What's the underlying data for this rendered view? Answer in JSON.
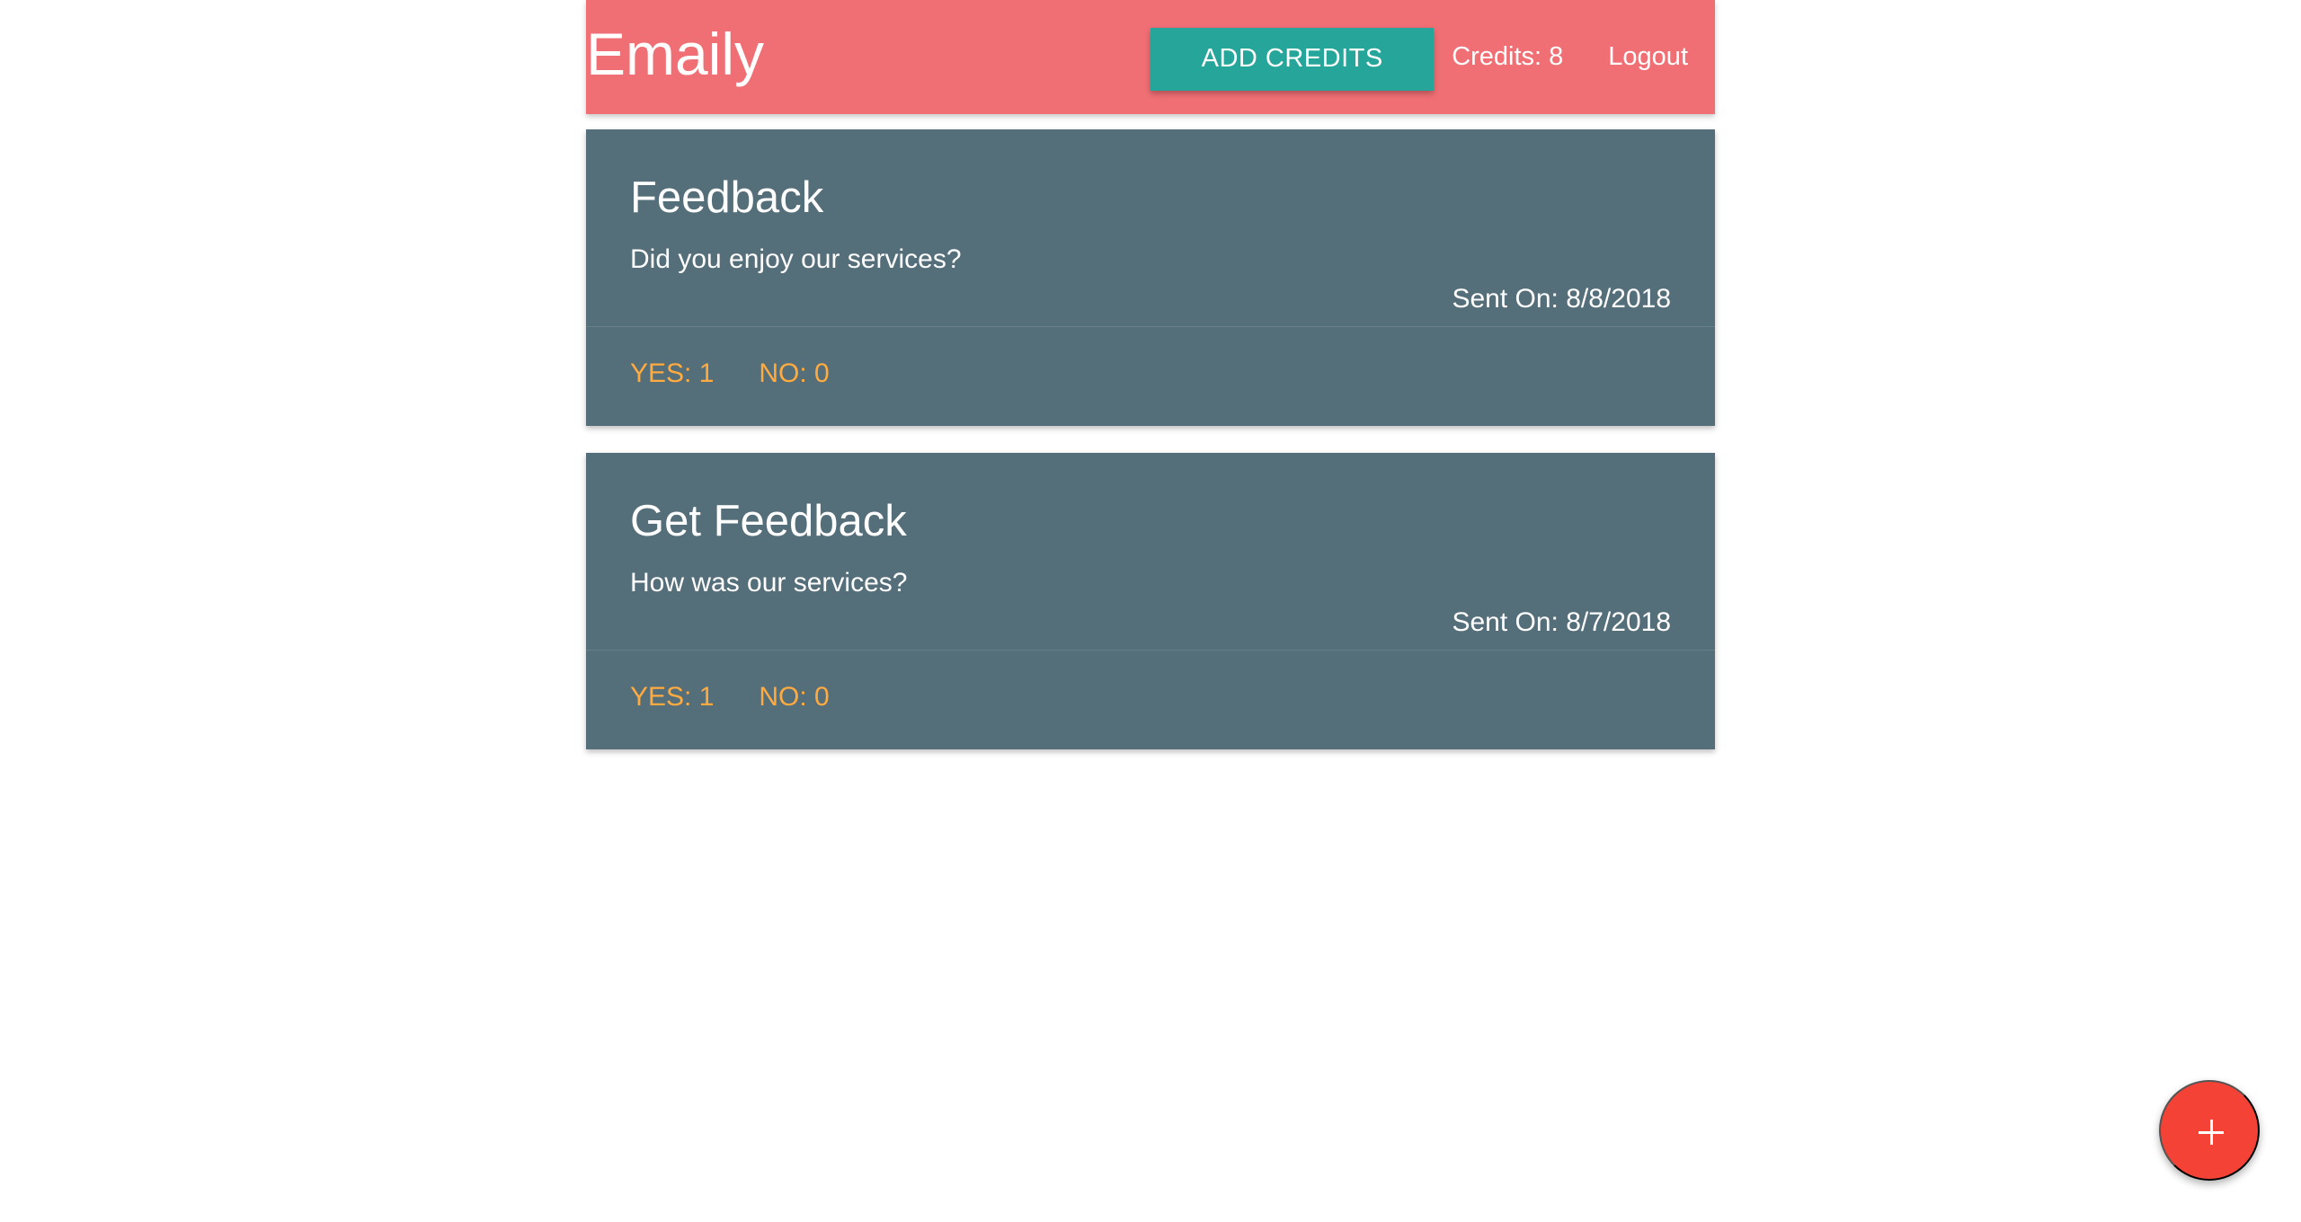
{
  "header": {
    "brand": "Emaily",
    "add_credits_label": "ADD CREDITS",
    "credits_text": "Credits: 8",
    "logout_label": "Logout"
  },
  "surveys": [
    {
      "title": "Feedback",
      "body": "Did you enjoy our services?",
      "sent_on": "Sent On: 8/8/2018",
      "yes": "YES: 1",
      "no": "NO: 0"
    },
    {
      "title": "Get Feedback",
      "body": "How was our services?",
      "sent_on": "Sent On: 8/7/2018",
      "yes": "YES: 1",
      "no": "NO: 0"
    }
  ],
  "fab": {
    "icon": "plus-icon"
  },
  "colors": {
    "navbar": "#ef6f74",
    "button": "#26a69a",
    "card": "#546e7a",
    "action": "#ffab40",
    "fab": "#f44336"
  }
}
